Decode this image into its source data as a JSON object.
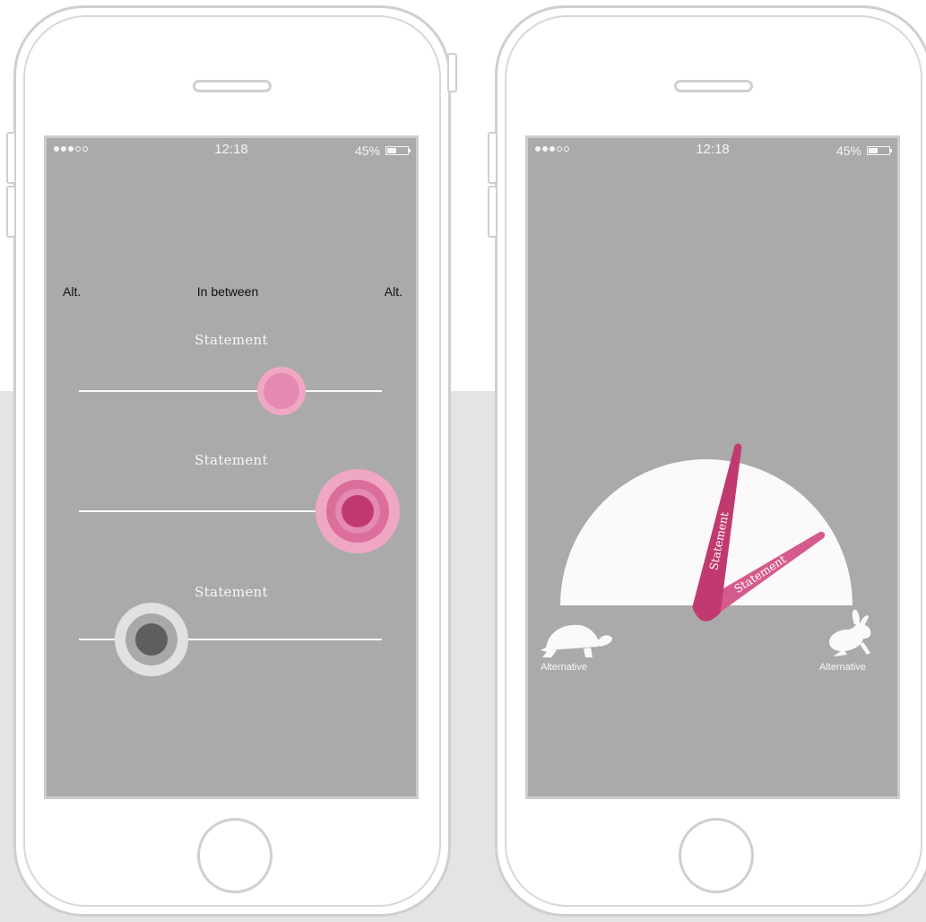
{
  "colors": {
    "screen_bg": "#aaaaaa",
    "device_outline": "#cfcfcf",
    "pink_light": "#f0a7c4",
    "pink_mid": "#e489b2",
    "pink_strong": "#db6e9b",
    "magenta": "#c03a70",
    "magenta_alt": "#d55a8d",
    "gray_light": "#e1e1e1",
    "gray_mid": "#a9a9a9",
    "gray_dark": "#5f5f5f"
  },
  "phones": [
    {
      "status_bar": {
        "signal_bars_filled": 3,
        "signal_bars_total": 5,
        "time": "12:18",
        "battery_percent_label": "45%",
        "battery_level": 0.45
      },
      "scale": {
        "left_label": "Alt.",
        "middle_label": "In between",
        "right_label": "Alt."
      },
      "sliders": [
        {
          "label": "Statement",
          "value": 0.67,
          "style": "pink-small",
          "icon": "pink-dot-knob"
        },
        {
          "label": "Statement",
          "value": 0.92,
          "style": "pink-large",
          "icon": "pink-ring-knob"
        },
        {
          "label": "Statement",
          "value": 0.24,
          "style": "gray-large",
          "icon": "gray-ring-knob"
        }
      ]
    },
    {
      "status_bar": {
        "signal_bars_filled": 3,
        "signal_bars_total": 5,
        "time": "12:18",
        "battery_percent_label": "45%",
        "battery_level": 0.45
      },
      "gauge": {
        "needles": [
          {
            "label": "Statement",
            "angle_deg": 79,
            "color": "magenta"
          },
          {
            "label": "Statement",
            "angle_deg": 33,
            "color": "magenta_alt"
          }
        ],
        "left": {
          "label": "Alternative",
          "icon": "turtle-icon"
        },
        "right": {
          "label": "Alternative",
          "icon": "rabbit-icon"
        }
      }
    }
  ]
}
